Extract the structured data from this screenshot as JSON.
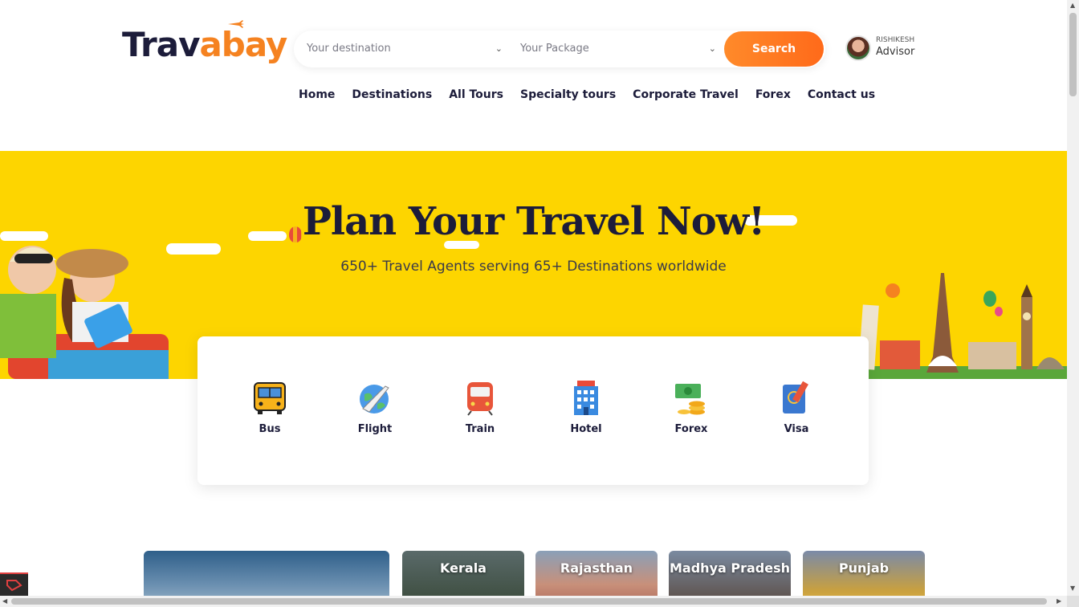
{
  "header": {
    "logo_part1": "Trav",
    "logo_part2": "abay",
    "search": {
      "destination_placeholder": "Your destination",
      "package_placeholder": "Your Package",
      "button_label": "Search"
    },
    "advisor": {
      "name": "RISHIKESH",
      "role": "Advisor"
    }
  },
  "nav": {
    "items": [
      "Home",
      "Destinations",
      "All Tours",
      "Specialty tours",
      "Corporate Travel",
      "Forex",
      "Contact us"
    ]
  },
  "hero": {
    "title": "Plan Your Travel Now!",
    "subtitle": "650+ Travel Agents serving 65+ Destinations worldwide",
    "background_color": "#fdd500"
  },
  "services": [
    {
      "label": "Bus",
      "icon": "bus-icon"
    },
    {
      "label": "Flight",
      "icon": "flight-icon"
    },
    {
      "label": "Train",
      "icon": "train-icon"
    },
    {
      "label": "Hotel",
      "icon": "hotel-icon"
    },
    {
      "label": "Forex",
      "icon": "forex-icon"
    },
    {
      "label": "Visa",
      "icon": "visa-icon"
    }
  ],
  "destinations": [
    {
      "name": ""
    },
    {
      "name": "Kerala"
    },
    {
      "name": "Rajasthan"
    },
    {
      "name": "Madhya Pradesh"
    },
    {
      "name": "Punjab"
    }
  ],
  "colors": {
    "accent": "#ff7a22",
    "brand_dark": "#1c1c3a"
  }
}
